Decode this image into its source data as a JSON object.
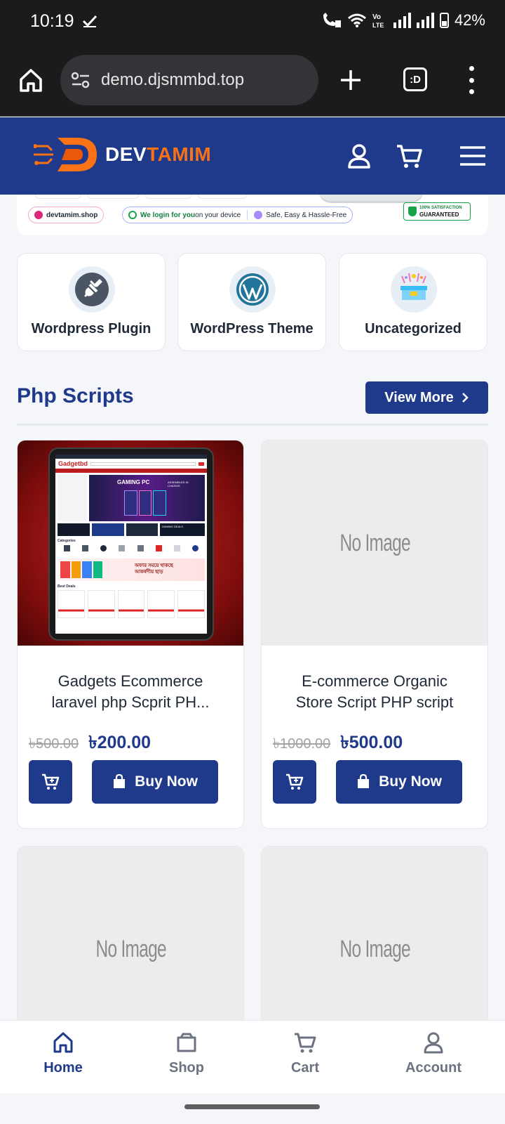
{
  "status_bar": {
    "time": "10:19",
    "battery": "42%"
  },
  "browser": {
    "url": "demo.djsmmbd.top",
    "tab_switcher_label": ":D"
  },
  "header": {
    "logo_part1": "DEV",
    "logo_part2": "TAMIM"
  },
  "banner": {
    "chips": [
      {
        "text": "devtamim.shop"
      },
      {
        "text_bold": "We login for you",
        "text_rest": " on your device"
      },
      {
        "text": "Safe, Easy & Hassle-Free"
      }
    ],
    "guarantee_line1": "100% SATISFACTION",
    "guarantee_line2": "GUARANTEED"
  },
  "categories": [
    {
      "label": "Wordpress Plugin",
      "icon": "plug-icon"
    },
    {
      "label": "WordPress Theme",
      "icon": "wordpress-icon"
    },
    {
      "label": "Uncategorized",
      "icon": "gift-box-icon"
    }
  ],
  "section": {
    "title": "Php Scripts",
    "view_more": "View More"
  },
  "products": [
    {
      "title_line1": "Gadgets Ecommerce",
      "title_line2": "laravel php Scprit PH...",
      "old_price": "৳500.00",
      "price": "৳200.00",
      "buy_label": "Buy Now",
      "thumb": {
        "site_name": "Gadgetbd",
        "hero_heading": "GAMING PC",
        "hero_right": "ASSEMBLED IN CHASSIS",
        "strip_label": "GAMING DEALS",
        "categories_heading": "Categories",
        "promo_text": "অফার সময়ে থাকছে আকর্ষণীয় ছাড়",
        "best_heading": "Best Deals"
      }
    },
    {
      "title_line1": "E-commerce Organic",
      "title_line2": "Store Script PHP script",
      "old_price": "৳1000.00",
      "price": "৳500.00",
      "buy_label": "Buy Now",
      "image_placeholder": "No Image"
    },
    {
      "image_placeholder": "No Image"
    },
    {
      "image_placeholder": "No Image"
    }
  ],
  "bottom_nav": [
    {
      "label": "Home",
      "active": true
    },
    {
      "label": "Shop",
      "active": false
    },
    {
      "label": "Cart",
      "active": false
    },
    {
      "label": "Account",
      "active": false
    }
  ],
  "colors": {
    "primary": "#1f3a8a",
    "accent": "#f97316",
    "status_bar": "#1b1b1b",
    "page_bg": "#f4f6f9"
  }
}
